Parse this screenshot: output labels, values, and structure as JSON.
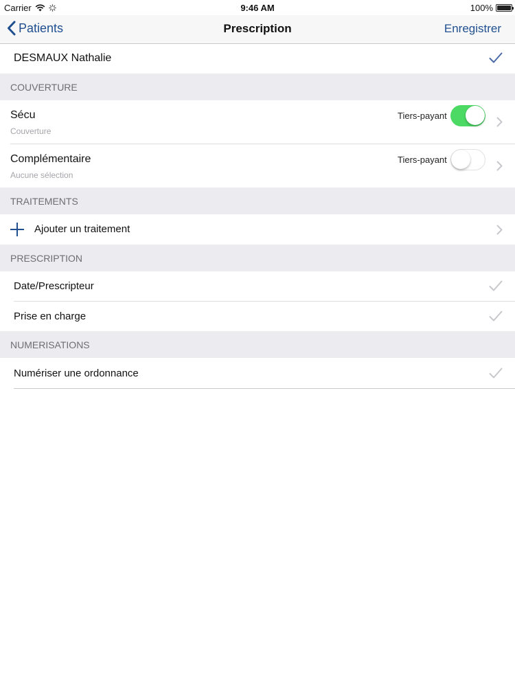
{
  "status_bar": {
    "carrier": "Carrier",
    "time": "9:46 AM",
    "battery": "100%"
  },
  "nav": {
    "back_label": "Patients",
    "title": "Prescription",
    "save_label": "Enregistrer"
  },
  "patient": {
    "name": "DESMAUX Nathalie"
  },
  "couverture": {
    "header": "COUVERTURE",
    "items": [
      {
        "title": "Sécu",
        "subtitle": "Couverture",
        "toggle_label": "Tiers-payant",
        "toggle_on": true
      },
      {
        "title": "Complémentaire",
        "subtitle": "Aucune sélection",
        "toggle_label": "Tiers-payant",
        "toggle_on": false
      }
    ]
  },
  "traitements": {
    "header": "TRAITEMENTS",
    "add_label": "Ajouter un traitement"
  },
  "prescription": {
    "header": "PRESCRIPTION",
    "items": [
      {
        "label": "Date/Prescripteur"
      },
      {
        "label": "Prise en charge"
      }
    ]
  },
  "numerisations": {
    "header": "NUMERISATIONS",
    "items": [
      {
        "label": "Numériser une ordonnance"
      }
    ]
  },
  "colors": {
    "accent": "#1f4f8f",
    "toggle_on": "#4cd964",
    "section_bg": "#ebebf0",
    "check_active": "#4a6aa8",
    "check_inactive": "#c7c7cc"
  },
  "icons": {
    "back": "chevron-left-icon",
    "check": "checkmark-icon",
    "disclosure": "chevron-right-icon",
    "add": "plus-icon",
    "wifi": "wifi-icon",
    "activity": "activity-spinner-icon",
    "battery": "battery-icon"
  }
}
